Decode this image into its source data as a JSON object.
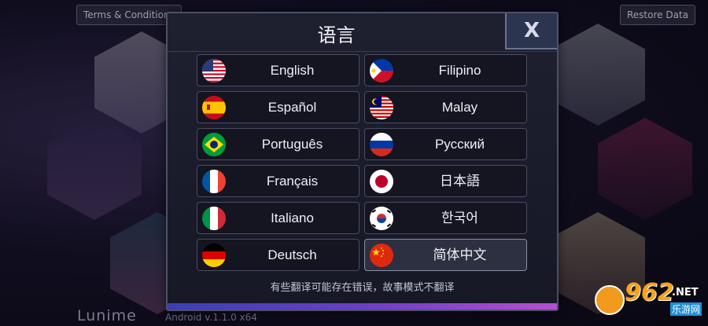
{
  "top_bar": {
    "terms_label": "Terms & Conditions",
    "restore_label": "Restore Data"
  },
  "footer": {
    "brand": "Lunime",
    "version": "Android v.1.1.0 x64"
  },
  "watermark": {
    "number": "962",
    "net": ".NET",
    "sub": "乐游网"
  },
  "dialog": {
    "title": "语言",
    "close_label": "X",
    "disclaimer": "有些翻译可能存在错误，故事模式不翻译",
    "languages": [
      {
        "label": "English",
        "flag": "us-flag-icon",
        "selected": false
      },
      {
        "label": "Filipino",
        "flag": "ph-flag-icon",
        "selected": false
      },
      {
        "label": "Español",
        "flag": "es-flag-icon",
        "selected": false
      },
      {
        "label": "Malay",
        "flag": "my-flag-icon",
        "selected": false
      },
      {
        "label": "Português",
        "flag": "br-flag-icon",
        "selected": false
      },
      {
        "label": "Русский",
        "flag": "ru-flag-icon",
        "selected": false
      },
      {
        "label": "Français",
        "flag": "fr-flag-icon",
        "selected": false
      },
      {
        "label": "日本語",
        "flag": "jp-flag-icon",
        "selected": false
      },
      {
        "label": "Italiano",
        "flag": "it-flag-icon",
        "selected": false
      },
      {
        "label": "한국어",
        "flag": "kr-flag-icon",
        "selected": false
      },
      {
        "label": "Deutsch",
        "flag": "de-flag-icon",
        "selected": false
      },
      {
        "label": "简体中文",
        "flag": "cn-flag-icon",
        "selected": true
      }
    ]
  },
  "colors": {
    "accent_gradient_start": "#3a3fb5",
    "accent_gradient_end": "#b64fd0",
    "dialog_bg": "#1e2030",
    "button_bg": "#141520"
  }
}
